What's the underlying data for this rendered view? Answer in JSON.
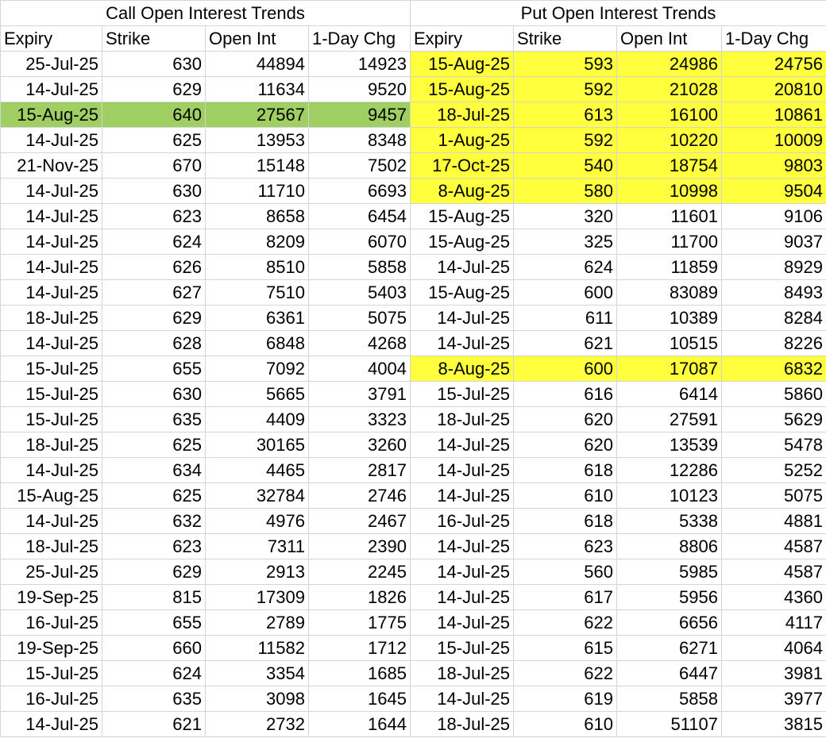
{
  "headers": {
    "call_title": "Call Open Interest Trends",
    "put_title": "Put Open Interest Trends",
    "columns": [
      "Expiry",
      "Strike",
      "Open Int",
      "1-Day Chg"
    ]
  },
  "colors": {
    "green_highlight": "#9fce63",
    "yellow_highlight": "#ffff3e",
    "grid": "#d4d4d4"
  },
  "calls": [
    {
      "expiry": "25-Jul-25",
      "strike": "630",
      "open_int": "44894",
      "chg": "14923"
    },
    {
      "expiry": "14-Jul-25",
      "strike": "629",
      "open_int": "11634",
      "chg": "9520"
    },
    {
      "expiry": "15-Aug-25",
      "strike": "640",
      "open_int": "27567",
      "chg": "9457"
    },
    {
      "expiry": "14-Jul-25",
      "strike": "625",
      "open_int": "13953",
      "chg": "8348"
    },
    {
      "expiry": "21-Nov-25",
      "strike": "670",
      "open_int": "15148",
      "chg": "7502"
    },
    {
      "expiry": "14-Jul-25",
      "strike": "630",
      "open_int": "11710",
      "chg": "6693"
    },
    {
      "expiry": "14-Jul-25",
      "strike": "623",
      "open_int": "8658",
      "chg": "6454"
    },
    {
      "expiry": "14-Jul-25",
      "strike": "624",
      "open_int": "8209",
      "chg": "6070"
    },
    {
      "expiry": "14-Jul-25",
      "strike": "626",
      "open_int": "8510",
      "chg": "5858"
    },
    {
      "expiry": "14-Jul-25",
      "strike": "627",
      "open_int": "7510",
      "chg": "5403"
    },
    {
      "expiry": "18-Jul-25",
      "strike": "629",
      "open_int": "6361",
      "chg": "5075"
    },
    {
      "expiry": "14-Jul-25",
      "strike": "628",
      "open_int": "6848",
      "chg": "4268"
    },
    {
      "expiry": "15-Jul-25",
      "strike": "655",
      "open_int": "7092",
      "chg": "4004"
    },
    {
      "expiry": "15-Jul-25",
      "strike": "630",
      "open_int": "5665",
      "chg": "3791"
    },
    {
      "expiry": "15-Jul-25",
      "strike": "635",
      "open_int": "4409",
      "chg": "3323"
    },
    {
      "expiry": "18-Jul-25",
      "strike": "625",
      "open_int": "30165",
      "chg": "3260"
    },
    {
      "expiry": "14-Jul-25",
      "strike": "634",
      "open_int": "4465",
      "chg": "2817"
    },
    {
      "expiry": "15-Aug-25",
      "strike": "625",
      "open_int": "32784",
      "chg": "2746"
    },
    {
      "expiry": "14-Jul-25",
      "strike": "632",
      "open_int": "4976",
      "chg": "2467"
    },
    {
      "expiry": "18-Jul-25",
      "strike": "623",
      "open_int": "7311",
      "chg": "2390"
    },
    {
      "expiry": "25-Jul-25",
      "strike": "629",
      "open_int": "2913",
      "chg": "2245"
    },
    {
      "expiry": "19-Sep-25",
      "strike": "815",
      "open_int": "17309",
      "chg": "1826"
    },
    {
      "expiry": "16-Jul-25",
      "strike": "655",
      "open_int": "2789",
      "chg": "1775"
    },
    {
      "expiry": "19-Sep-25",
      "strike": "660",
      "open_int": "11582",
      "chg": "1712"
    },
    {
      "expiry": "15-Jul-25",
      "strike": "624",
      "open_int": "3354",
      "chg": "1685"
    },
    {
      "expiry": "16-Jul-25",
      "strike": "635",
      "open_int": "3098",
      "chg": "1645"
    },
    {
      "expiry": "14-Jul-25",
      "strike": "621",
      "open_int": "2732",
      "chg": "1644"
    }
  ],
  "puts": [
    {
      "expiry": "15-Aug-25",
      "strike": "593",
      "open_int": "24986",
      "chg": "24756"
    },
    {
      "expiry": "15-Aug-25",
      "strike": "592",
      "open_int": "21028",
      "chg": "20810"
    },
    {
      "expiry": "18-Jul-25",
      "strike": "613",
      "open_int": "16100",
      "chg": "10861"
    },
    {
      "expiry": "1-Aug-25",
      "strike": "592",
      "open_int": "10220",
      "chg": "10009"
    },
    {
      "expiry": "17-Oct-25",
      "strike": "540",
      "open_int": "18754",
      "chg": "9803"
    },
    {
      "expiry": "8-Aug-25",
      "strike": "580",
      "open_int": "10998",
      "chg": "9504"
    },
    {
      "expiry": "15-Aug-25",
      "strike": "320",
      "open_int": "11601",
      "chg": "9106"
    },
    {
      "expiry": "15-Aug-25",
      "strike": "325",
      "open_int": "11700",
      "chg": "9037"
    },
    {
      "expiry": "14-Jul-25",
      "strike": "624",
      "open_int": "11859",
      "chg": "8929"
    },
    {
      "expiry": "15-Aug-25",
      "strike": "600",
      "open_int": "83089",
      "chg": "8493"
    },
    {
      "expiry": "14-Jul-25",
      "strike": "611",
      "open_int": "10389",
      "chg": "8284"
    },
    {
      "expiry": "14-Jul-25",
      "strike": "621",
      "open_int": "10515",
      "chg": "8226"
    },
    {
      "expiry": "8-Aug-25",
      "strike": "600",
      "open_int": "17087",
      "chg": "6832"
    },
    {
      "expiry": "15-Jul-25",
      "strike": "616",
      "open_int": "6414",
      "chg": "5860"
    },
    {
      "expiry": "18-Jul-25",
      "strike": "620",
      "open_int": "27591",
      "chg": "5629"
    },
    {
      "expiry": "14-Jul-25",
      "strike": "620",
      "open_int": "13539",
      "chg": "5478"
    },
    {
      "expiry": "14-Jul-25",
      "strike": "618",
      "open_int": "12286",
      "chg": "5252"
    },
    {
      "expiry": "14-Jul-25",
      "strike": "610",
      "open_int": "10123",
      "chg": "5075"
    },
    {
      "expiry": "16-Jul-25",
      "strike": "618",
      "open_int": "5338",
      "chg": "4881"
    },
    {
      "expiry": "14-Jul-25",
      "strike": "623",
      "open_int": "8806",
      "chg": "4587"
    },
    {
      "expiry": "14-Jul-25",
      "strike": "560",
      "open_int": "5985",
      "chg": "4587"
    },
    {
      "expiry": "14-Jul-25",
      "strike": "617",
      "open_int": "5956",
      "chg": "4360"
    },
    {
      "expiry": "14-Jul-25",
      "strike": "622",
      "open_int": "6656",
      "chg": "4117"
    },
    {
      "expiry": "15-Jul-25",
      "strike": "615",
      "open_int": "6271",
      "chg": "4064"
    },
    {
      "expiry": "18-Jul-25",
      "strike": "622",
      "open_int": "6447",
      "chg": "3981"
    },
    {
      "expiry": "14-Jul-25",
      "strike": "619",
      "open_int": "5858",
      "chg": "3977"
    },
    {
      "expiry": "18-Jul-25",
      "strike": "610",
      "open_int": "51107",
      "chg": "3815"
    }
  ],
  "highlights": {
    "call_green_rows": [
      2
    ],
    "put_yellow_rows": [
      0,
      1,
      2,
      3,
      4,
      5,
      12
    ]
  }
}
